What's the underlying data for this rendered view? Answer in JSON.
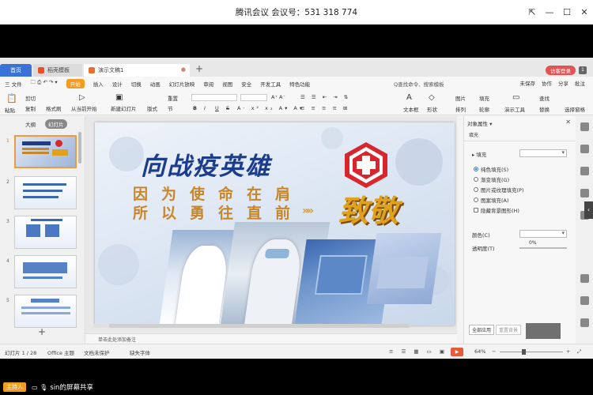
{
  "meeting": {
    "title": "腾讯会议 会议号：531 318 774",
    "controls": [
      "⇱",
      "—",
      "☐",
      "✕"
    ],
    "host_badge": "主持人",
    "share_label": "sin的屏幕共享"
  },
  "tabs": [
    {
      "label": "首页"
    },
    {
      "label": "稻壳模板"
    },
    {
      "label": "演示文稿1"
    }
  ],
  "login_label": "访客登录",
  "menu": {
    "file": "三 文件",
    "items": [
      "开始",
      "插入",
      "设计",
      "切换",
      "动画",
      "幻灯片放映",
      "审阅",
      "视图",
      "安全",
      "开发工具",
      "特色功能"
    ],
    "search": "Q查找命令、搜索模板",
    "right": [
      "未保存",
      "协作",
      "分享",
      "批注"
    ]
  },
  "ribbon": {
    "paste": "粘贴",
    "cut": "剪切",
    "copy": "复制",
    "format_painter": "格式刷",
    "from_start": "从当前开始",
    "new_slide": "新建幻灯片",
    "layout": "版式",
    "section": "节",
    "reset": "重置",
    "font_buttons": [
      "B",
      "I",
      "U",
      "S"
    ],
    "textbox": "文本框",
    "shape": "形状",
    "arrange": "排列",
    "picture": "图片",
    "fill": "填充",
    "outline": "轮廓",
    "presentation_tools": "演示工具",
    "find": "查找",
    "replace": "替换",
    "select_pane": "选择窗格"
  },
  "left_pane": {
    "view_tabs": [
      "大纲",
      "幻灯片"
    ],
    "slide_numbers": [
      "1",
      "2",
      "3",
      "4",
      "5"
    ],
    "add": "+"
  },
  "slide": {
    "title": "向战疫英雄",
    "line1": "因为使命在肩",
    "line2": "所以勇往直前",
    "chevrons": "»»",
    "big_text": "致敬"
  },
  "notes_placeholder": "单击此处添加备注",
  "props": {
    "header": "对象属性 ▾",
    "tab": "填充",
    "fill_section": "▸ 填充",
    "options": [
      {
        "label": "纯色填充(S)",
        "selected": true
      },
      {
        "label": "渐变填充(G)",
        "selected": false
      },
      {
        "label": "图片或纹理填充(P)",
        "selected": false
      },
      {
        "label": "图案填充(A)",
        "selected": false
      }
    ],
    "hide_bg": "隐藏背景图形(H)",
    "color_label": "颜色(C)",
    "transparency_label": "透明度(T)",
    "transparency_value": "0%",
    "apply_all": "全部应用",
    "reset_bg": "重置背景"
  },
  "status": {
    "slide_count": "幻灯片 1 / 28",
    "theme": "Office 主题",
    "protect": "文档未保护",
    "missing_font": "缺失字体",
    "zoom": "64%"
  }
}
